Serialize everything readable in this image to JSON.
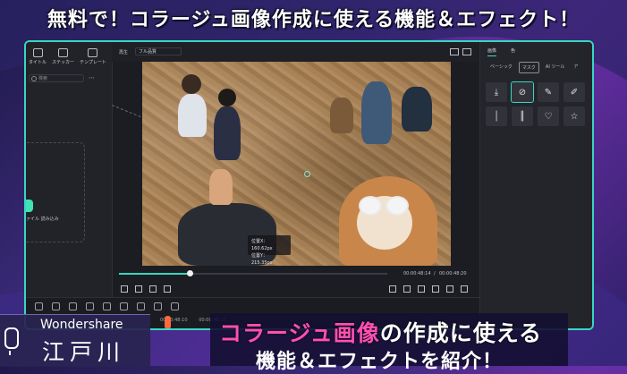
{
  "banner": {
    "title": "無料で！コラージュ画像作成に使える機能＆エフェクト！"
  },
  "left_panel": {
    "tabs": [
      {
        "label": "タイトル",
        "icon": "title-icon"
      },
      {
        "label": "ステッカー",
        "icon": "sticker-icon"
      },
      {
        "label": "テンプレート",
        "icon": "template-icon"
      }
    ],
    "search_placeholder": "検索",
    "card_label": "ァイル 読み込み"
  },
  "preview_bar": {
    "label": "再生",
    "quality": "フル品質"
  },
  "tooltip": {
    "line1": "位置X：160.62px",
    "line2": "位置Y：215.35px"
  },
  "player": {
    "current_time": "00:00:48:14",
    "separator": "/",
    "total_time": "00:00:48:20"
  },
  "right_panel": {
    "tabs": [
      "画像",
      "色"
    ],
    "subtabs": [
      "ベーシック",
      "マスク",
      "AI ツール",
      "ア"
    ],
    "shapes": [
      "download-icon",
      "no-mask-icon",
      "brush-icon",
      "eraser-icon",
      "line-icon",
      "double-line-icon",
      "heart-icon",
      "star-icon"
    ]
  },
  "timeline": {
    "ticks": [
      "00:00:48:10",
      "00:00:48:15"
    ]
  },
  "lower_left": {
    "brand": "Wondershare",
    "city": "江戸川"
  },
  "caption": {
    "line1_pink": "コラージュ画像",
    "line1_white": "の作成に使える",
    "line2": "機能＆エフェクトを紹介！"
  }
}
